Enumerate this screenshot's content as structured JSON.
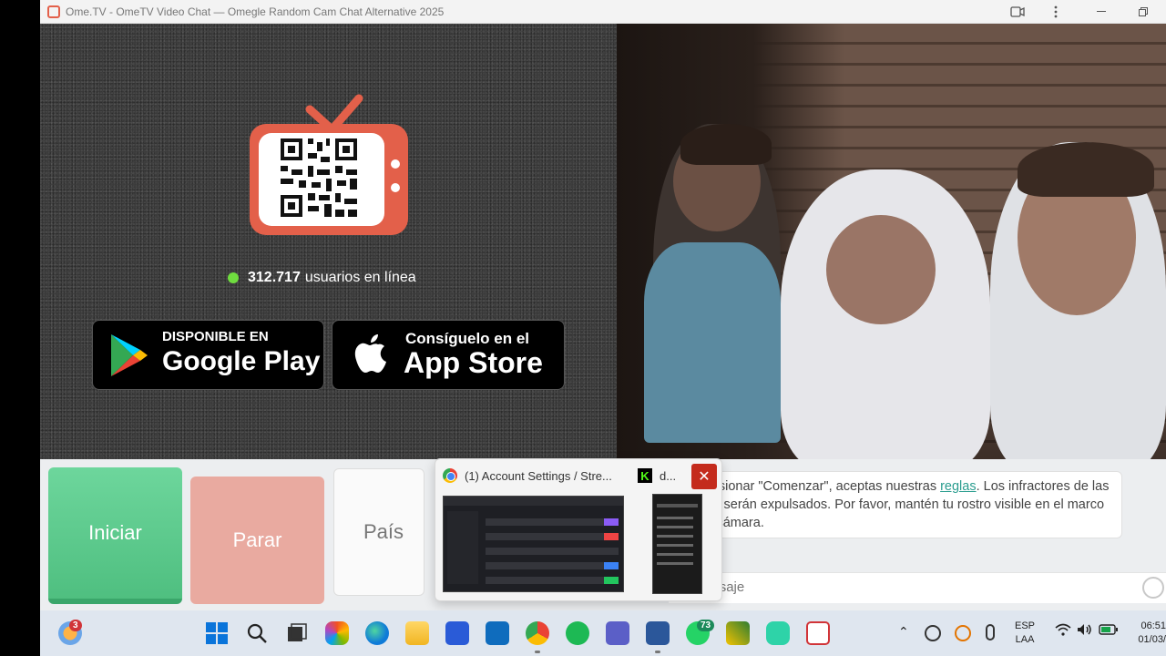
{
  "window": {
    "title": "Ome.TV - OmeTV Video Chat — Omegle Random Cam Chat Alternative 2025",
    "camera_icon": "camera-icon",
    "menu_icon": "more-vertical-icon",
    "minimize_icon": "minimize-icon",
    "restore_icon": "restore-icon"
  },
  "promo": {
    "online_count": "312.717",
    "online_label": "usuarios en línea",
    "online_dot_color": "#6fdc3f",
    "logo_color": "#e3604a",
    "google_play": {
      "small": "DISPONIBLE EN",
      "big": "Google Play"
    },
    "app_store": {
      "small": "Consíguelo en el",
      "big": "App Store"
    }
  },
  "controls": {
    "start_label": "Iniciar",
    "stop_label": "Parar",
    "country_label": "País"
  },
  "notice": {
    "before_link": "Al presionar \"Comenzar\", aceptas nuestras ",
    "link": "reglas",
    "after_link": ". Los infractores de las reglas serán expulsados. Por favor, mantén tu rostro visible en el marco de la cámara."
  },
  "message": {
    "placeholder": "n mensaje"
  },
  "preview": {
    "window1_title": "(1) Account Settings / Stre...",
    "window2_title": "d...",
    "close_symbol": "✕"
  },
  "taskbar": {
    "weather_badge": "3",
    "whatsapp_badge": "73",
    "lang_top": "ESP",
    "lang_bottom": "LAA",
    "time": "06:51",
    "date": "01/03/"
  }
}
